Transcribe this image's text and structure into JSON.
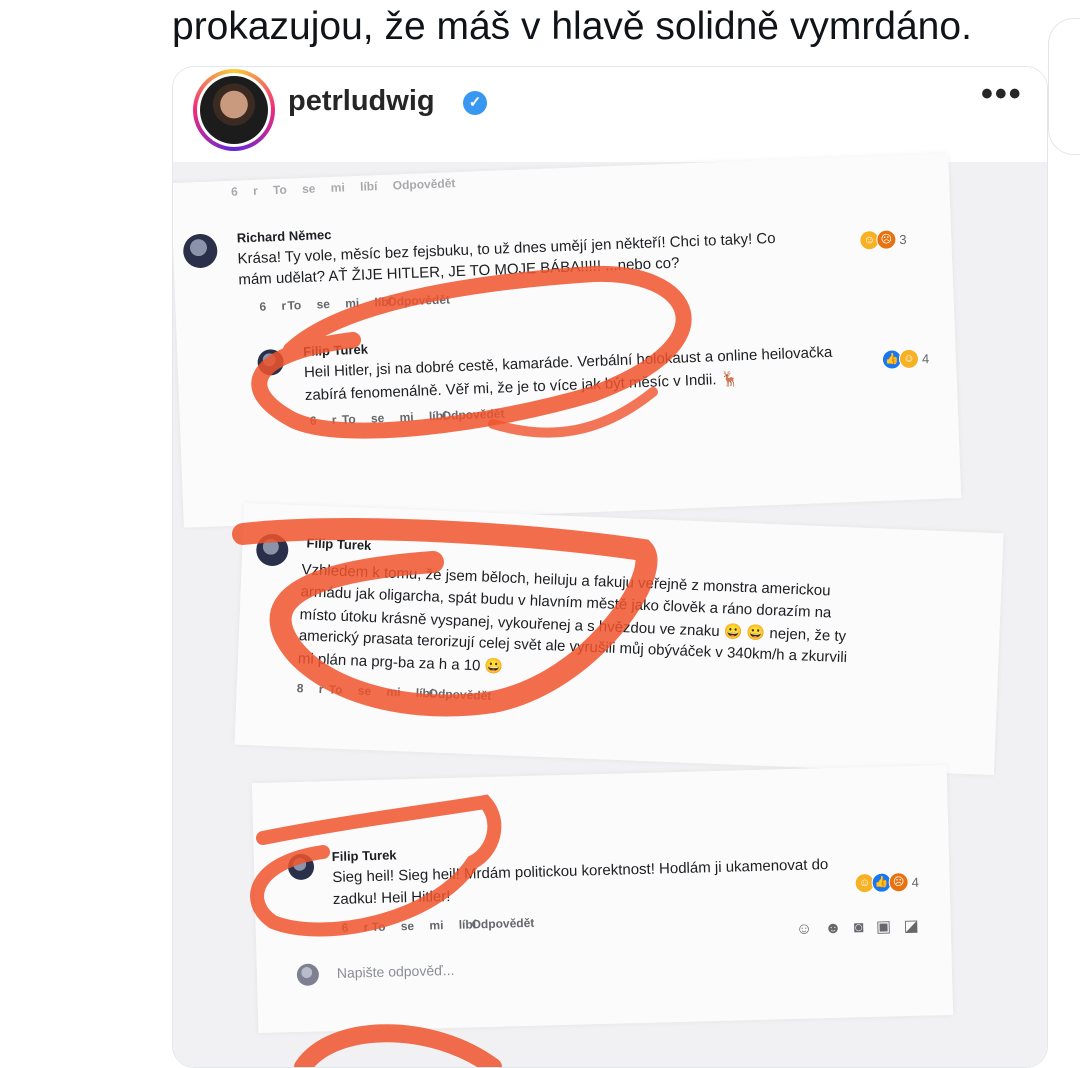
{
  "tweet": {
    "text": "prokazujou, že máš v hlavě solidně vymrdáno."
  },
  "embed": {
    "username": "petrludwig",
    "verified_mark": "✓",
    "more_label": "•••",
    "icons": {
      "verified": "verified-badge-icon",
      "more": "more-options-icon"
    },
    "brand_colors": {
      "verified": "#3897f0",
      "highlight": "#f0542d"
    }
  },
  "screenshot": {
    "cut_top_meta": "6 r   To se mi líbí   Odpovědět",
    "comments": [
      {
        "name": "Richard Němec",
        "lines": [
          "Krása! Ty vole, měsíc bez fejsbuku, to už dnes umějí jen někteří! Chci to taky! Co",
          "mám udělat? AŤ ŽIJE HITLER, JE TO MOJE BÁBA!!!!! ...nebo co?"
        ],
        "reaction_count": "3",
        "age": "6 r",
        "like": "To se mi líbí",
        "reply": "Odpovědět"
      },
      {
        "name": "Filip Turek",
        "lines": [
          "Heil Hitler, jsi na dobré cestě, kamaráde. Verbální holokaust a online heilovačka",
          "zabírá fenomenálně. Věř mi, že je to více jak být měsíc v Indii. 🦌"
        ],
        "reaction_count": "4",
        "age": "6 r",
        "like": "To se mi líbí",
        "reply": "Odpovědět"
      },
      {
        "name": "Filip Turek",
        "lines": [
          "Vzhledem k tomu, že jsem běloch, heiluju a fakuju veřejně z monstra americkou",
          "armádu jak oligarcha, spát budu v hlavním městě jako člověk a ráno dorazím na",
          "místo útoku krásně vyspanej, vykouřenej a s hvězdou ve znaku 😀 😀 nejen, že ty",
          "americký prasata terorizují celej svět ale vyrušili můj obýváček v 340km/h a zkurvili",
          "mi plán na prg-ba za h a 10 😀"
        ],
        "age": "8 r",
        "like": "To se mi líbí",
        "reply": "Odpovědět"
      },
      {
        "name": "Filip Turek",
        "lines": [
          "Sieg heil! Sieg heil! Mrdám politickou korektnost! Hodlám ji ukamenovat do",
          "zadku! Heil Hitler!"
        ],
        "reaction_count": "4",
        "age": "6 r",
        "like": "To se mi líbí",
        "reply": "Odpovědět"
      }
    ],
    "composer_placeholder": "Napište odpověď...",
    "composer_icons": [
      "sticker-icon",
      "emoji-icon",
      "camera-icon",
      "gif-icon",
      "sticker-pack-icon"
    ]
  }
}
